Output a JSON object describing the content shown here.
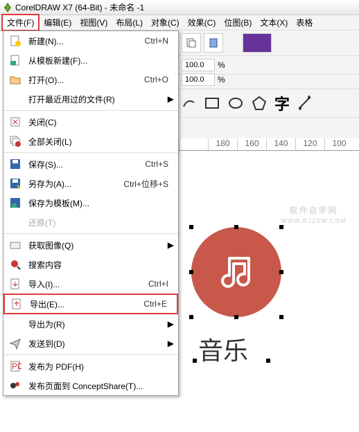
{
  "title": "CorelDRAW X7 (64-Bit) - 未命名 -1",
  "menubar": [
    "文件(F)",
    "编辑(E)",
    "视图(V)",
    "布局(L)",
    "对象(C)",
    "效果(C)",
    "位图(B)",
    "文本(X)",
    "表格"
  ],
  "dropdown": [
    {
      "icon": "new",
      "label": "新建(N)...",
      "shortcut": "Ctrl+N",
      "arrow": false
    },
    {
      "icon": "tpl",
      "label": "从模板新建(F)...",
      "shortcut": "",
      "arrow": false
    },
    {
      "icon": "open",
      "label": "打开(O)...",
      "shortcut": "Ctrl+O",
      "arrow": false
    },
    {
      "icon": "",
      "label": "打开最近用过的文件(R)",
      "shortcut": "",
      "arrow": true
    },
    {
      "sep": true
    },
    {
      "icon": "close",
      "label": "关闭(C)",
      "shortcut": "",
      "arrow": false
    },
    {
      "icon": "closeall",
      "label": "全部关闭(L)",
      "shortcut": "",
      "arrow": false
    },
    {
      "sep": true
    },
    {
      "icon": "save",
      "label": "保存(S)...",
      "shortcut": "Ctrl+S",
      "arrow": false
    },
    {
      "icon": "saveas",
      "label": "另存为(A)...",
      "shortcut": "Ctrl+位移+S",
      "arrow": false
    },
    {
      "icon": "savetpl",
      "label": "保存为模板(M)...",
      "shortcut": "",
      "arrow": false
    },
    {
      "icon": "",
      "label": "还原(T)",
      "shortcut": "",
      "arrow": false,
      "disabled": true
    },
    {
      "sep": true
    },
    {
      "icon": "acquire",
      "label": "获取图像(Q)",
      "shortcut": "",
      "arrow": true
    },
    {
      "icon": "search",
      "label": "搜索内容",
      "shortcut": "",
      "arrow": false
    },
    {
      "icon": "import",
      "label": "导入(I)...",
      "shortcut": "Ctrl+I",
      "arrow": false
    },
    {
      "icon": "export",
      "label": "导出(E)...",
      "shortcut": "Ctrl+E",
      "arrow": false,
      "highlight": true
    },
    {
      "icon": "",
      "label": "导出为(R)",
      "shortcut": "",
      "arrow": true
    },
    {
      "icon": "send",
      "label": "发送到(D)",
      "shortcut": "",
      "arrow": true
    },
    {
      "sep": true
    },
    {
      "icon": "pdf",
      "label": "发布为 PDF(H)",
      "shortcut": "",
      "arrow": false
    },
    {
      "icon": "concept",
      "label": "发布页面到 ConceptShare(T)...",
      "shortcut": "",
      "arrow": false
    }
  ],
  "numfields": {
    "a": "100.0",
    "b": "100.0"
  },
  "ruler": [
    "",
    "180",
    "160",
    "140",
    "120",
    "100"
  ],
  "watermark": {
    "main": "软件自学网",
    "sub": "WWW.RJZXW.COM"
  },
  "canvas_label": "音乐",
  "shape_glyph": "字"
}
